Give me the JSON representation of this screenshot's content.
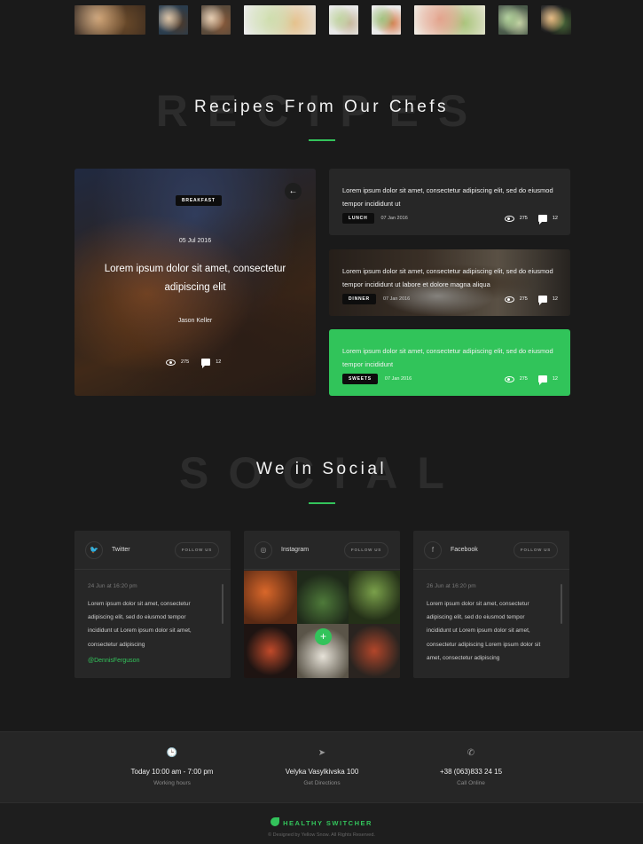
{
  "thumbnails": [
    {
      "name": "burger",
      "colors": [
        "#3a2a1e",
        "#b77a3a",
        "#6a4a2a"
      ]
    },
    {
      "name": "hands-bowl",
      "colors": [
        "#2a3c4c",
        "#c7a47a",
        "#4e3a2a"
      ]
    },
    {
      "name": "fruit-plate",
      "colors": [
        "#5a4a3a",
        "#d7b28a",
        "#8a5a3a"
      ]
    },
    {
      "name": "meal-prep-boxes",
      "colors": [
        "#eaeaea",
        "#b9cf8a",
        "#e5c08a"
      ]
    },
    {
      "name": "salad-white",
      "colors": [
        "#e8e8e8",
        "#a6c27a",
        "#c7b59a"
      ]
    },
    {
      "name": "veggie-bowls",
      "colors": [
        "#eaeaea",
        "#7aa84a",
        "#d77a4a"
      ]
    },
    {
      "name": "fruit-board",
      "colors": [
        "#efe9e0",
        "#d77a5a",
        "#a8c47a"
      ]
    },
    {
      "name": "green-salad",
      "colors": [
        "#4a5a4a",
        "#8ab86a",
        "#c9d4a8"
      ]
    },
    {
      "name": "spices",
      "colors": [
        "#1a1a1a",
        "#d79a4a",
        "#4a6a3a"
      ]
    }
  ],
  "recipes_section": {
    "bg_word": "RECIPES",
    "title": "Recipes From Our Chefs"
  },
  "featured": {
    "tag": "BREAKFAST",
    "date": "05 Jul 2016",
    "title": "Lorem ipsum dolor sit amet, consectetur adipiscing elit",
    "author": "Jason Keller",
    "views": "275",
    "comments": "12",
    "back_glyph": "←"
  },
  "cards": {
    "lunch": {
      "text": "Lorem ipsum dolor sit amet, consectetur adipiscing elit, sed do eiusmod tempor incididunt ut",
      "tag": "LUNCH",
      "date": "07 Jan 2016",
      "views": "275",
      "comments": "12"
    },
    "dinner": {
      "text": "Lorem ipsum dolor sit amet, consectetur adipiscing elit, sed do eiusmod tempor incididunt ut labore et dolore magna aliqua",
      "tag": "DINNER",
      "date": "07 Jan 2016",
      "views": "275",
      "comments": "12"
    },
    "sweets": {
      "text": "Lorem ipsum dolor sit amet, consectetur adipiscing elit, sed do eiusmod tempor incididunt",
      "tag": "SWEETS",
      "date": "07 Jan 2016",
      "views": "275",
      "comments": "12"
    }
  },
  "social_section": {
    "bg_word": "SOCIAL",
    "title": "We in Social"
  },
  "twitter": {
    "icon_glyph": "🐦",
    "name": "Twitter",
    "follow": "FOLLOW US",
    "date": "24 Jun at 16:20 pm",
    "body": "Lorem ipsum dolor sit amet, consectetur adipiscing elit, sed do eiusmod tempor incididunt ut Lorem ipsum dolor sit amet, consectetur adipiscing",
    "handle": "@DennisFerguson"
  },
  "instagram": {
    "icon_glyph": "◎",
    "name": "Instagram",
    "follow": "FOLLOW US",
    "plus": "+"
  },
  "facebook": {
    "icon_glyph": "f",
    "name": "Facebook",
    "follow": "FOLLOW US",
    "date": "26 Jun at 16:20 pm",
    "body": "Lorem ipsum dolor sit amet, consectetur adipiscing elit, sed do eiusmod tempor incididunt ut Lorem ipsum dolor sit amet, consectetur adipiscing Lorem ipsum dolor sit amet, consectetur adipiscing"
  },
  "contact": {
    "hours": {
      "icon": "🕒",
      "main": "Today 10:00 am - 7:00 pm",
      "sub": "Working hours"
    },
    "address": {
      "icon": "➤",
      "main": "Velyka Vasylkivska 100",
      "sub": "Get Directions"
    },
    "phone": {
      "icon": "✆",
      "main": "+38 (063)833 24 15",
      "sub": "Call Online"
    }
  },
  "footer": {
    "brand": "HEALTHY SWITCHER",
    "copyright": "© Designed by Yellow Snow. All Rights Reserved."
  },
  "colors": {
    "accent": "#33c35b",
    "background": "#1a1a1a",
    "card": "#272727"
  }
}
